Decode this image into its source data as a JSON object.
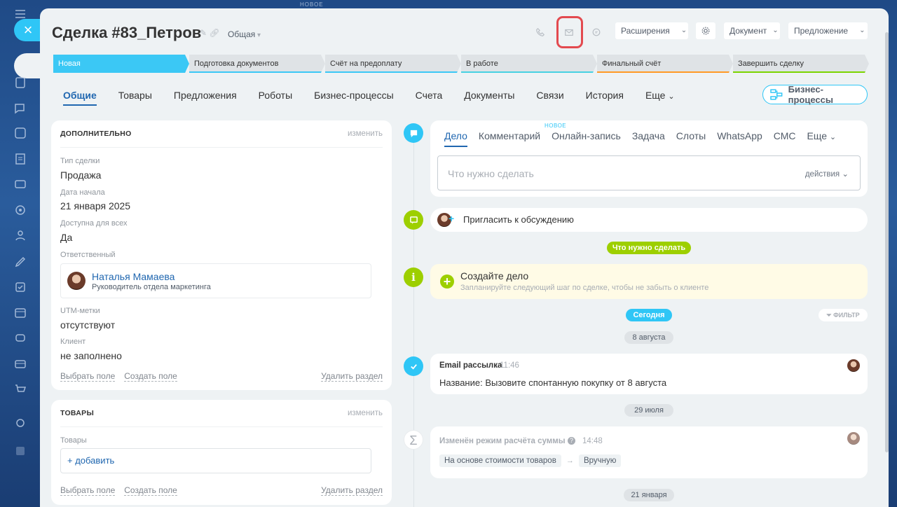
{
  "top_new_badge": "НОВОЕ",
  "deal": {
    "title": "Сделка #83_Петров",
    "pipeline": "Общая"
  },
  "header": {
    "extensions": "Расширения",
    "document": "Документ",
    "proposal": "Предложение"
  },
  "stages": [
    {
      "label": "Новая",
      "color": "#3bc8f5",
      "line": "#3bc8f5"
    },
    {
      "label": "Подготовка документов",
      "color": "#dfe3e6",
      "line": "#3bc8f5"
    },
    {
      "label": "Счёт на предоплату",
      "color": "#dfe3e6",
      "line": "#3bc8f5"
    },
    {
      "label": "В работе",
      "color": "#dfe3e6",
      "line": "#47d1e2"
    },
    {
      "label": "Финальный счёт",
      "color": "#dfe3e6",
      "line": "#ff9a25"
    },
    {
      "label": "Завершить сделку",
      "color": "#dfe3e6",
      "line": "#7bd500"
    }
  ],
  "tabs": [
    "Общие",
    "Товары",
    "Предложения",
    "Роботы",
    "Бизнес-процессы",
    "Счета",
    "Документы",
    "Связи",
    "История",
    "Еще"
  ],
  "bp_button": "Бизнес-процессы",
  "extra_card": {
    "header": "ДОПОЛНИТЕЛЬНО",
    "edit": "изменить",
    "fields": [
      {
        "label": "Тип сделки",
        "value": "Продажа"
      },
      {
        "label": "Дата начала",
        "value": "21 января 2025"
      },
      {
        "label": "Доступна для всех",
        "value": "Да"
      },
      {
        "label": "Ответственный",
        "value": ""
      },
      {
        "label": "UTM-метки",
        "value": "отсутствуют"
      },
      {
        "label": "Клиент",
        "value": "не заполнено"
      }
    ],
    "responsible": {
      "name": "Наталья Мамаева",
      "position": "Руководитель отдела маркетинга"
    },
    "choose_field": "Выбрать поле",
    "create_field": "Создать поле",
    "delete_section": "Удалить раздел"
  },
  "products_card": {
    "header": "ТОВАРЫ",
    "edit": "изменить",
    "label": "Товары",
    "add": "+ добавить",
    "choose_field": "Выбрать поле",
    "create_field": "Создать поле",
    "delete_section": "Удалить раздел"
  },
  "activity": {
    "tabs": [
      "Дело",
      "Комментарий",
      "Онлайн-запись",
      "Задача",
      "Слоты",
      "WhatsApp",
      "СМС",
      "Еще"
    ],
    "new_badge": "НОВОЕ",
    "placeholder": "Что нужно сделать",
    "actions": "действия"
  },
  "invite": "Пригласить к обсуждению",
  "todo_pill": "Что нужно сделать",
  "create_task": {
    "title": "Создайте дело",
    "subtitle": "Запланируйте следующий шаг по сделке, чтобы не забыть о клиенте"
  },
  "today_pill": "Сегодня",
  "filter": "ФИЛЬТР",
  "dates": [
    "8 августа",
    "29 июля",
    "21 января"
  ],
  "email_event": {
    "title": "Email рассылка",
    "time": "11:46",
    "text": "Название: Вызовите спонтанную покупку от 8 августа"
  },
  "sum_event": {
    "title": "Изменён режим расчёта суммы",
    "time": "14:48",
    "from": "На основе стоимости товаров",
    "to": "Вручную"
  }
}
